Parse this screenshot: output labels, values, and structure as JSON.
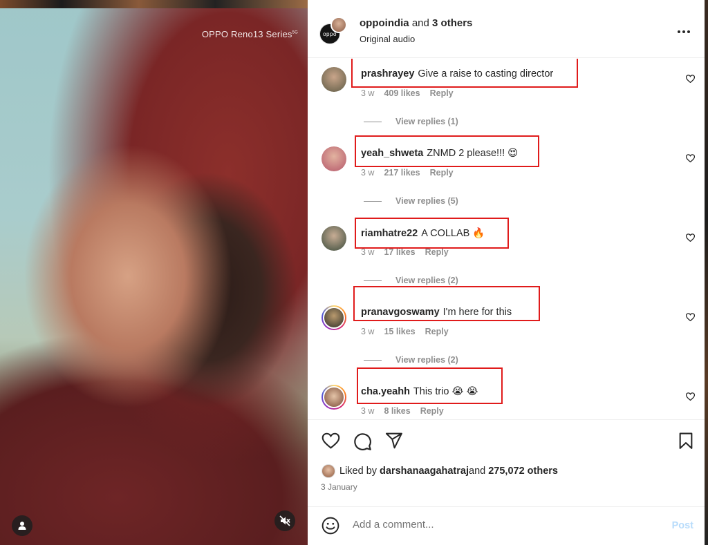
{
  "media": {
    "watermark": "OPPO Reno13 Series",
    "watermark_sup": "5G"
  },
  "header": {
    "avatar_text": "oppo",
    "owner_name": "oppoindia",
    "owner_joiner": " and ",
    "owner_others": "3 others",
    "audio": "Original audio",
    "more_icon": "more-horizontal-icon"
  },
  "comments": [
    {
      "user": "prashrayey",
      "text": "Give a raise to casting director",
      "emoji": "",
      "time": "3 w",
      "likes": "409 likes",
      "reply": "Reply",
      "view_replies": "View replies (1)",
      "avatar_color": "#6b6b55"
    },
    {
      "user": "yeah_shweta",
      "text": "ZNMD 2 please!!!",
      "emoji": "😍",
      "time": "3 w",
      "likes": "217 likes",
      "reply": "Reply",
      "view_replies": "View replies (5)",
      "avatar_color": "#c98a7a"
    },
    {
      "user": "riamhatre22",
      "text": "A COLLAB",
      "emoji": "🔥",
      "time": "3 w",
      "likes": "17 likes",
      "reply": "Reply",
      "view_replies": "View replies (2)",
      "avatar_color": "#4b5a4a"
    },
    {
      "user": "pranavgoswamy",
      "text": "I'm here for this",
      "emoji": "",
      "time": "3 w",
      "likes": "15 likes",
      "reply": "Reply",
      "view_replies": "View replies (2)",
      "avatar_color": "#3a3a32"
    },
    {
      "user": "cha.yeahh",
      "text": "This trio",
      "emoji": "😭 😭",
      "time": "3 w",
      "likes": "8 likes",
      "reply": "Reply",
      "view_replies": "",
      "avatar_color": "#c9a080"
    }
  ],
  "liked_by": {
    "prefix": "Liked by ",
    "user": "darshanaagahatraj",
    "joiner": " and ",
    "others": "275,072 others"
  },
  "date": "3 January",
  "add_comment": {
    "placeholder": "Add a comment...",
    "post_label": "Post"
  },
  "colors": {
    "highlight": "#e01b1b",
    "post_disabled": "#b8dcfb"
  }
}
